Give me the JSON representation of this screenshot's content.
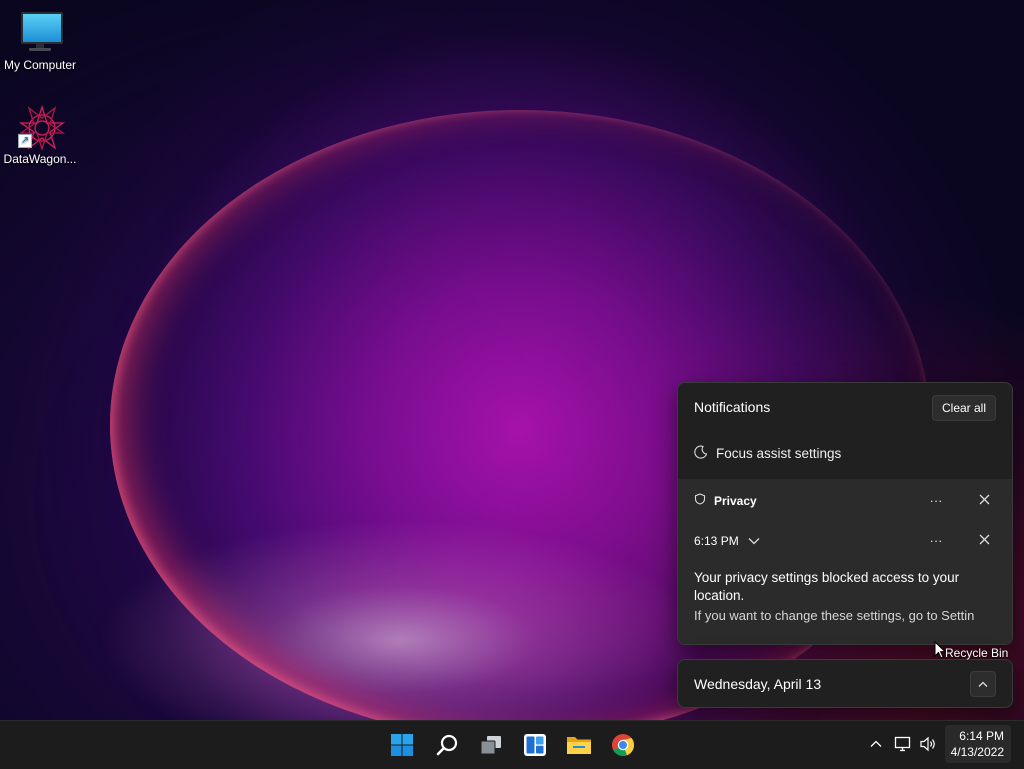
{
  "desktop": {
    "icons": [
      {
        "label": "My Computer",
        "icon": "monitor-icon"
      },
      {
        "label": "DataWagon...",
        "icon": "datawagon-app-icon"
      }
    ],
    "recycle_bin_label": "Recycle Bin"
  },
  "notification_center": {
    "title": "Notifications",
    "clear_all_label": "Clear all",
    "focus_assist_label": "Focus assist settings",
    "notification": {
      "app_name": "Privacy",
      "more_label": "···",
      "time": "6:13 PM",
      "title": "Your privacy settings blocked access to your location.",
      "body": "If you want to change these settings, go to Settin"
    }
  },
  "calendar_flyout": {
    "date_label": "Wednesday, April 13"
  },
  "taskbar": {
    "apps": [
      {
        "name": "start-button",
        "icon": "windows-logo-icon"
      },
      {
        "name": "search-button",
        "icon": "search-icon"
      },
      {
        "name": "task-view-button",
        "icon": "task-view-icon"
      },
      {
        "name": "widgets-button",
        "icon": "widgets-icon"
      },
      {
        "name": "file-explorer-button",
        "icon": "folder-icon"
      },
      {
        "name": "chrome-button",
        "icon": "chrome-icon"
      }
    ],
    "tray": {
      "icons": [
        "chevron-up-icon",
        "network-icon",
        "volume-icon"
      ],
      "time": "6:14 PM",
      "date": "4/13/2022"
    }
  },
  "colors": {
    "accent": "#0078d4",
    "panel_bg": "#202020",
    "card_bg": "#2b2b2b",
    "taskbar_bg": "#1c1c1c"
  }
}
